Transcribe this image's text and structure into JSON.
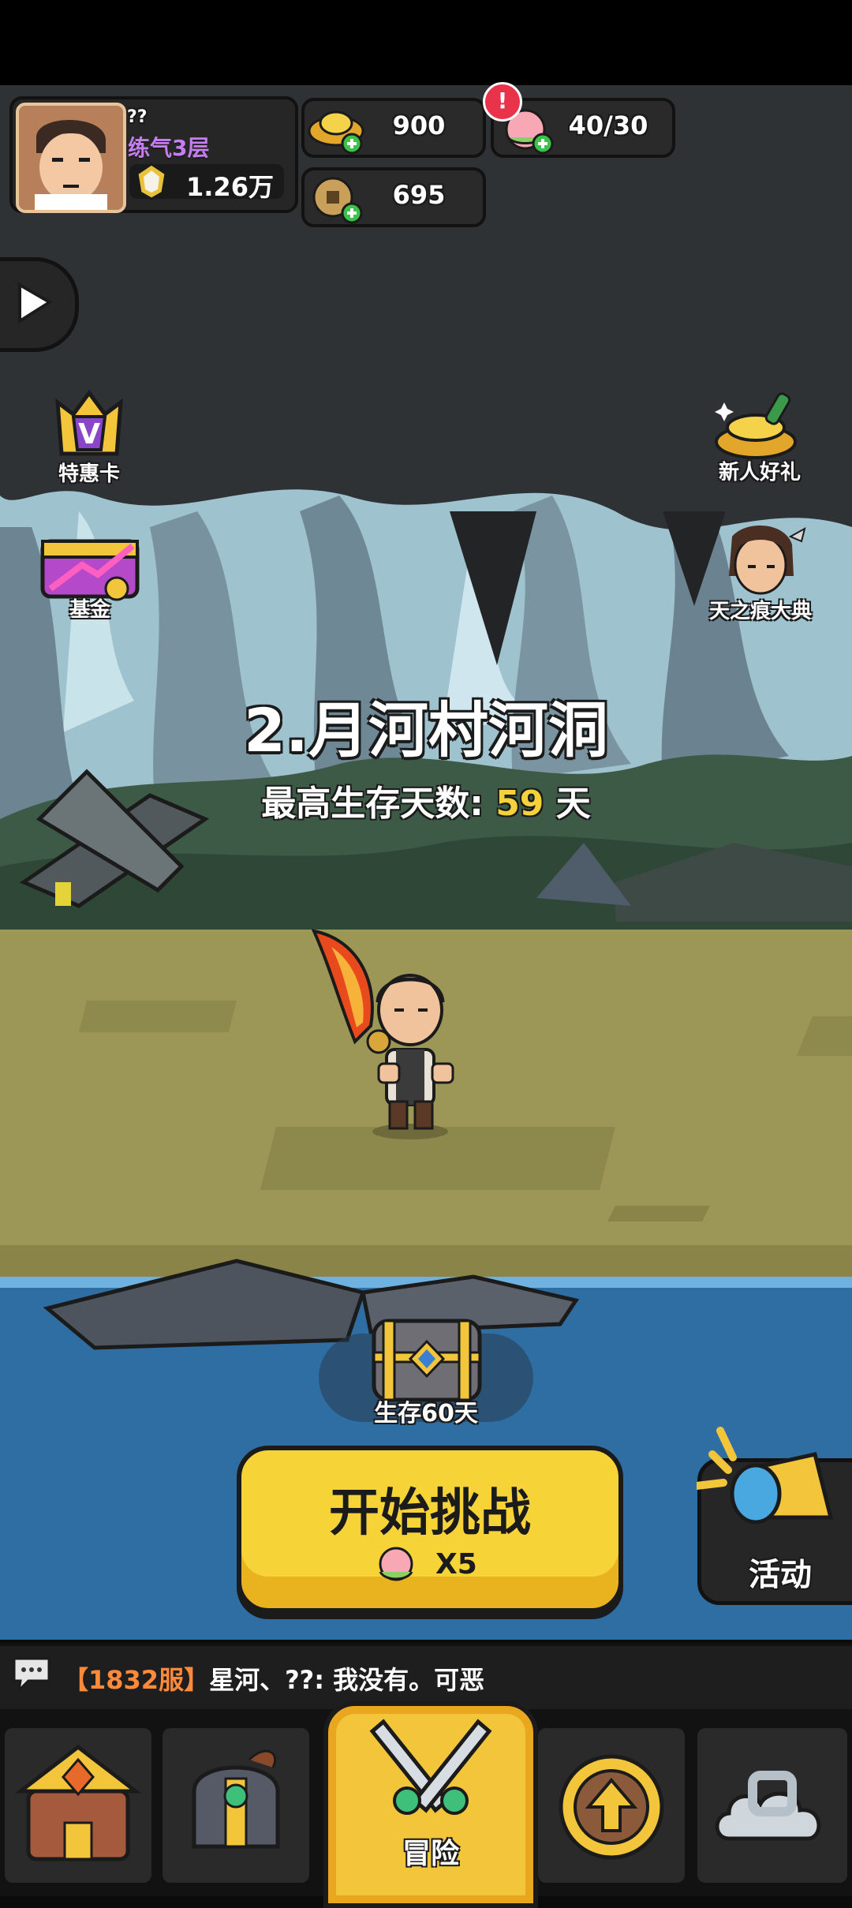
{
  "player": {
    "name": "??",
    "realm": "练气3层",
    "power": "1.26万"
  },
  "resources": {
    "gold": "900",
    "peach": "40/30",
    "coin": "695"
  },
  "left_buttons": {
    "vip_card": "特惠卡",
    "fund": "基金"
  },
  "right_buttons": {
    "newbie_gift": "新人好礼",
    "event_book": "天之痕大典"
  },
  "stage": {
    "title": "2.月河村河洞",
    "best_label": "最高生存天数:",
    "best_days": "59",
    "day_unit": "天"
  },
  "reward_chest": {
    "label": "生存60天"
  },
  "start_button": {
    "label": "开始挑战",
    "cost": "X5"
  },
  "activity_button": {
    "label": "活动"
  },
  "chat": {
    "server": "【1832服】",
    "message": "星河、??: 我没有。可恶"
  },
  "bottom_nav": {
    "active_label": "冒险"
  },
  "colors": {
    "accent_yellow": "#f6d437",
    "realm_purple": "#c47ef0",
    "server_orange": "#ff8a3a",
    "best_days_yellow": "#f5d13c"
  }
}
